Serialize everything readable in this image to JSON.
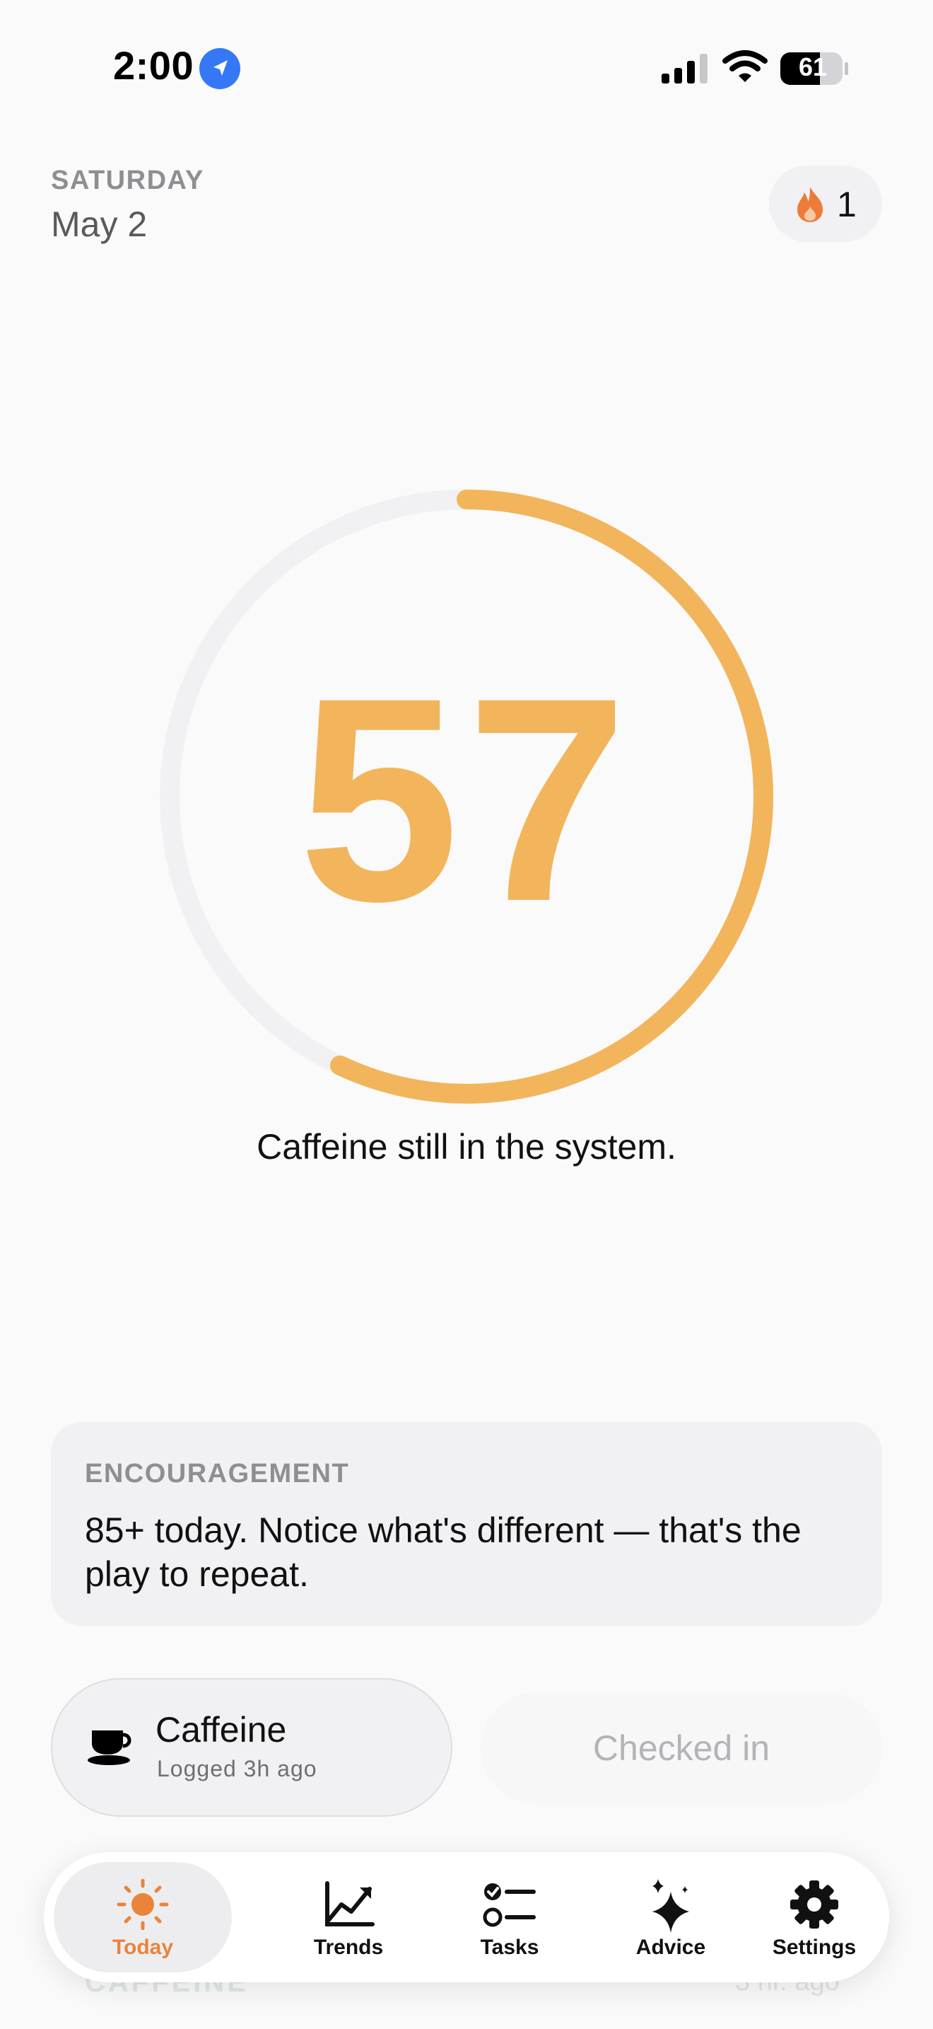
{
  "status_bar": {
    "time": "2:00",
    "battery": "61"
  },
  "header": {
    "day": "SATURDAY",
    "date": "May 2",
    "streak_count": "1"
  },
  "score": {
    "value": "57",
    "progress_fraction": 0.57,
    "caption": "Caffeine still in the system."
  },
  "encouragement": {
    "label": "ENCOURAGEMENT",
    "text": "85+ today. Notice what's different — that's the play to repeat."
  },
  "caffeine": {
    "title": "Caffeine",
    "subtitle": "Logged 3h ago"
  },
  "checkin": {
    "label": "Checked in"
  },
  "background_peek": {
    "label": "CAFFEINE",
    "time": "3 hr. ago"
  },
  "tabs": [
    {
      "label": "Today",
      "icon": "sun-icon",
      "active": true
    },
    {
      "label": "Trends",
      "icon": "trend-chart-icon",
      "active": false
    },
    {
      "label": "Tasks",
      "icon": "checklist-icon",
      "active": false
    },
    {
      "label": "Advice",
      "icon": "sparkles-icon",
      "active": false
    },
    {
      "label": "Settings",
      "icon": "gear-icon",
      "active": false
    }
  ],
  "colors": {
    "accent": "#f2b55c",
    "ring_track": "#f1f1f4",
    "active_tab": "#e9843a",
    "flame": "#ee7b3a",
    "location": "#3478f6"
  }
}
